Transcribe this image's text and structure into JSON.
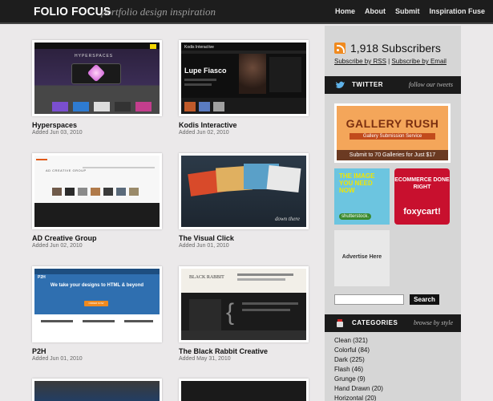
{
  "header": {
    "logo": "FOLIO FOCUS",
    "tagline": "portfolio design inspiration",
    "nav": [
      "Home",
      "About",
      "Submit",
      "Inspiration Fuse"
    ]
  },
  "portfolios": [
    {
      "title": "Hyperspaces",
      "date": "Added Jun 03, 2010"
    },
    {
      "title": "Kodis Interactive",
      "date": "Added Jun 02, 2010"
    },
    {
      "title": "AD Creative Group",
      "date": "Added Jun 02, 2010"
    },
    {
      "title": "The Visual Click",
      "date": "Added Jun 01, 2010"
    },
    {
      "title": "P2H",
      "date": "Added Jun 01, 2010"
    },
    {
      "title": "The Black Rabbit Creative",
      "date": "Added May 31, 2010"
    }
  ],
  "thumb_text": {
    "hyper": "HYPERSPACES",
    "kodis_brand": "Kodis Interactive",
    "kodis_name": "Lupe Fiasco",
    "ad_brand": "AD CREATIVE GROUP",
    "visual": "down there",
    "p2h_logo": "P2H",
    "p2h_headline": "We take your designs to HTML & beyond",
    "p2h_cta": "ORDER NOW",
    "rabbit": "BLACK RABBIT"
  },
  "sidebar": {
    "subscribers": "1,918 Subscribers",
    "rss_link": "Subscribe by RSS",
    "email_link": "Subscribe by Email",
    "separator": "|",
    "twitter_title": "TWITTER",
    "twitter_sub": "follow our tweets",
    "ads": {
      "gallery_title": "GALLERY RUSH",
      "gallery_sub": "Gallery Submission Service",
      "gallery_cta": "Submit to 70 Galleries for Just $17",
      "shutter_text": "THE IMAGE YOU NEED NOW",
      "shutter_logo": "shutterstock.",
      "foxy_text": "ECOMMERCE DONE RIGHT",
      "foxy_logo": "foxycart!",
      "advertise": "Advertise Here"
    },
    "search_button": "Search",
    "search_placeholder": "",
    "categories_title": "CATEGORIES",
    "categories_sub": "browse by style",
    "categories": [
      "Clean (321)",
      "Colorful (84)",
      "Dark (225)",
      "Flash (46)",
      "Grunge (9)",
      "Hand Drawn (20)",
      "Horizontal (20)"
    ]
  },
  "colors": {
    "header_bg": "#1d1d1d",
    "page_bg": "#ebe9ea",
    "sidebar_bg": "#d6d6d6",
    "rss_orange": "#f08a1f",
    "gallery_rush_bg": "#f4a65a",
    "foxycart_red": "#c8102e"
  },
  "icons": [
    "rss-icon",
    "twitter-bird-icon",
    "categories-icon"
  ]
}
